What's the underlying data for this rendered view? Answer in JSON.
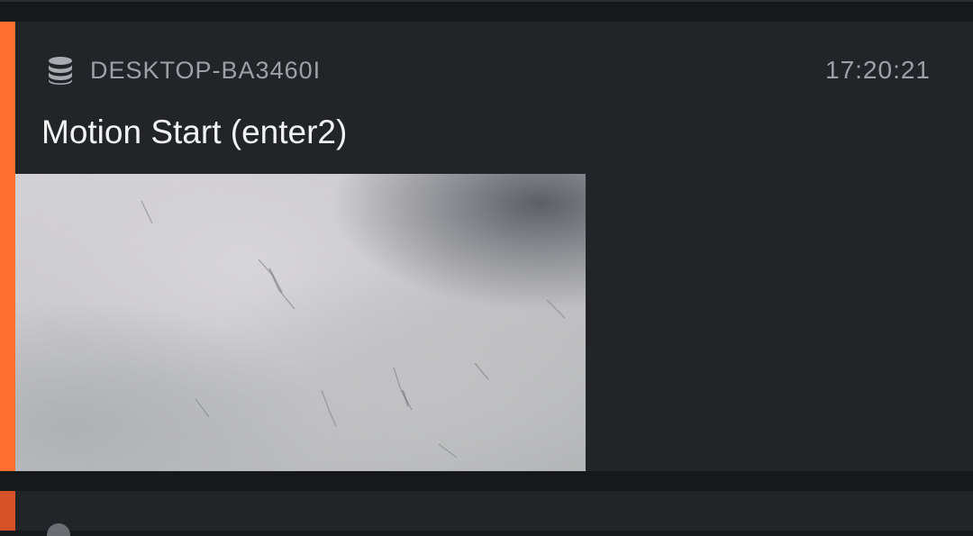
{
  "event": {
    "source_icon": "database-icon",
    "source_name": "DESKTOP-BA3460I",
    "time": "17:20:21",
    "title": "Motion Start (enter2)",
    "accent_color": "#ff6f2f"
  },
  "next_event": {
    "accent_color": "#d6532a"
  }
}
